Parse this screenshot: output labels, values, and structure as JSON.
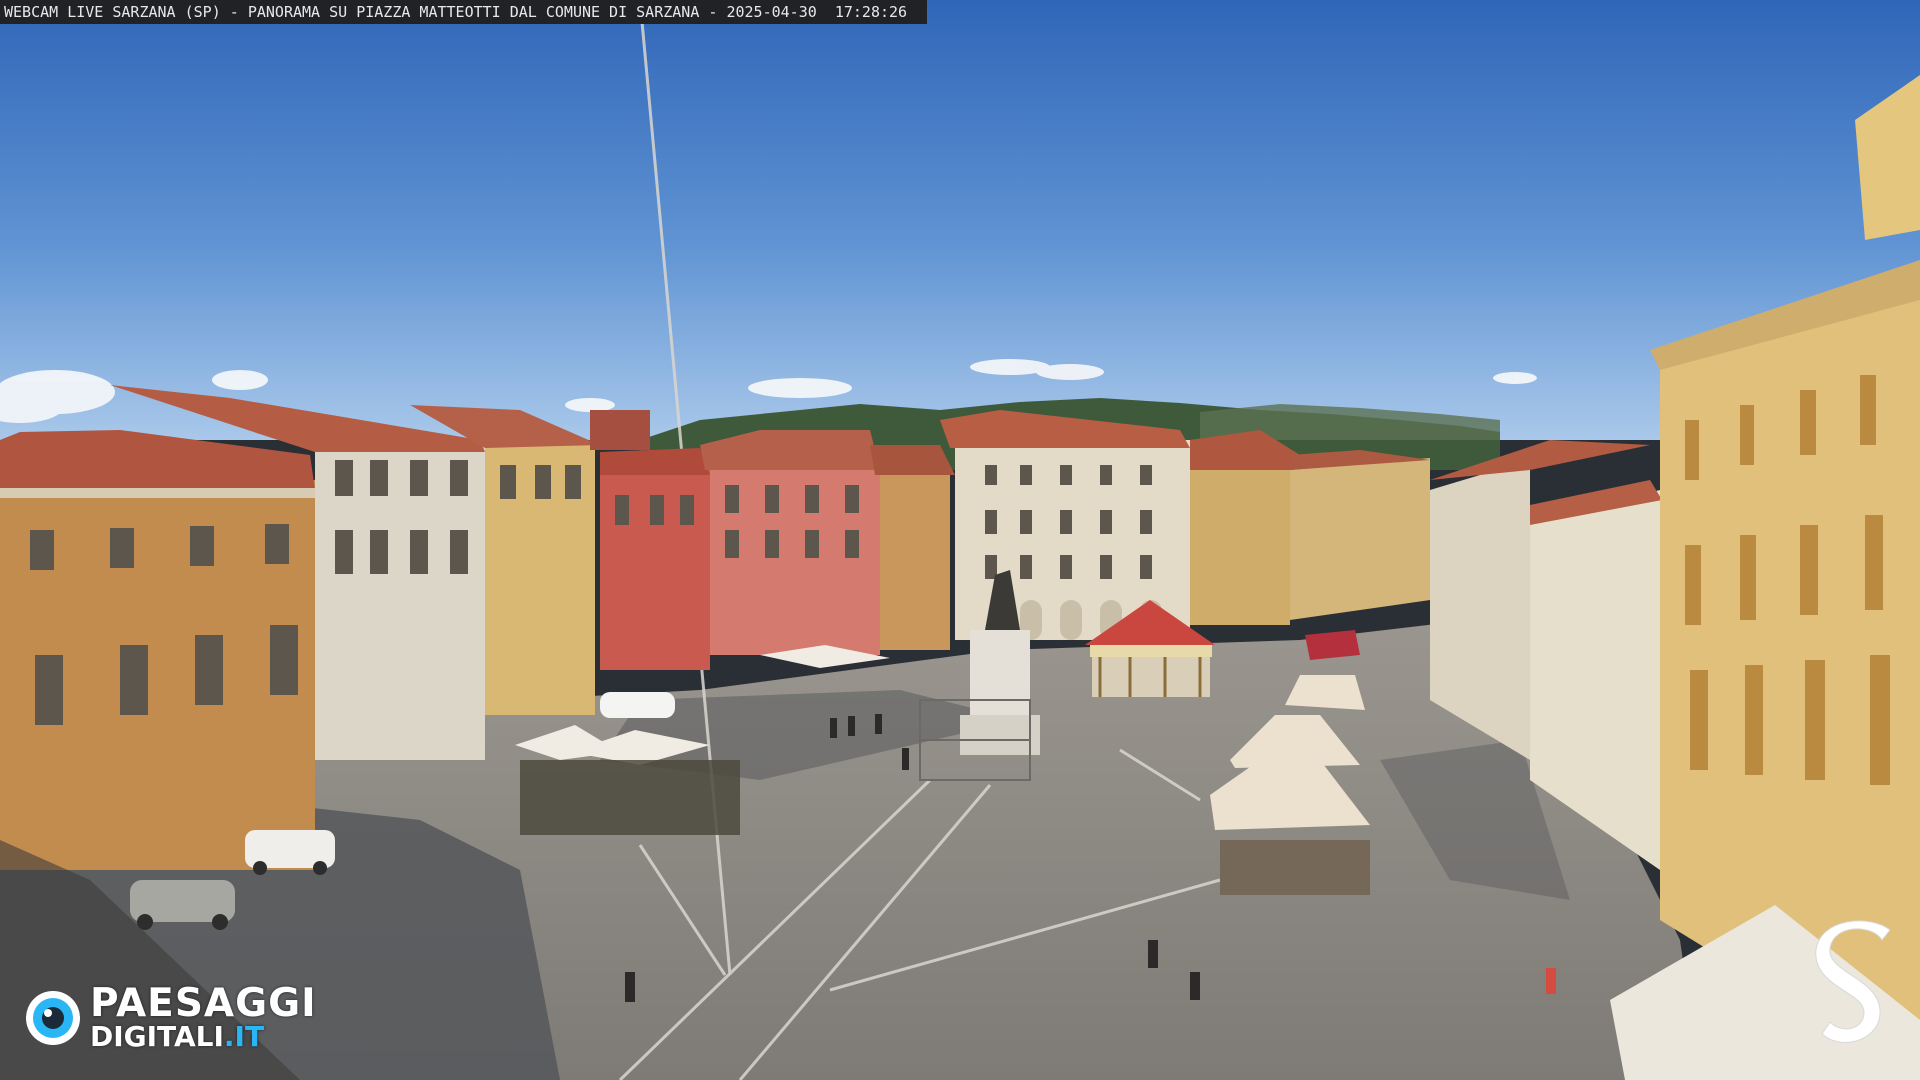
{
  "caption": "WEBCAM LIVE SARZANA (SP) - PANORAMA SU PIAZZA MATTEOTTI DAL COMUNE DI SARZANA - 2025-04-30  17:28:26",
  "logo": {
    "line1": "PAESAGGI",
    "line2_main": "DIGITALI",
    "line2_tld": ".IT",
    "accent_color": "#29b6f6",
    "icon": "eye-lens-icon"
  },
  "corner_mark": {
    "icon": "stylized-s-icon"
  },
  "colors": {
    "sky_top": "#2f66b8",
    "sky_bottom": "#9fc1e6",
    "pavement": "#8d8a84",
    "shadow": "#4b4c4e"
  }
}
